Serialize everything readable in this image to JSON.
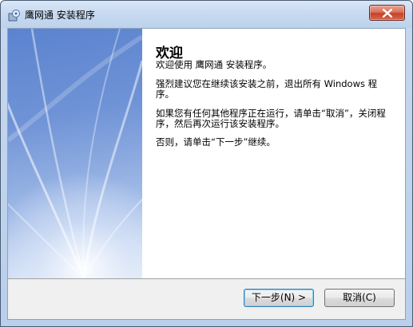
{
  "window": {
    "title": "鹰网通 安装程序"
  },
  "content": {
    "heading": "欢迎",
    "paragraphs": [
      "欢迎使用 鹰网通  安装程序。",
      "强烈建议您在继续该安装之前，退出所有 Windows 程序。",
      "如果您有任何其他程序正在运行，请单击“取消”，关闭程序，然后再次运行该安装程序。",
      "否则，请单击“下一步”继续。"
    ]
  },
  "buttons": {
    "next": "下一步(N) >",
    "cancel": "取消(C)"
  },
  "icons": {
    "app": "setup-icon",
    "close": "close-icon"
  },
  "colors": {
    "close_button": "#c7402a",
    "title_bar": "#c8daf0",
    "left_panel": "#6f93d6"
  }
}
